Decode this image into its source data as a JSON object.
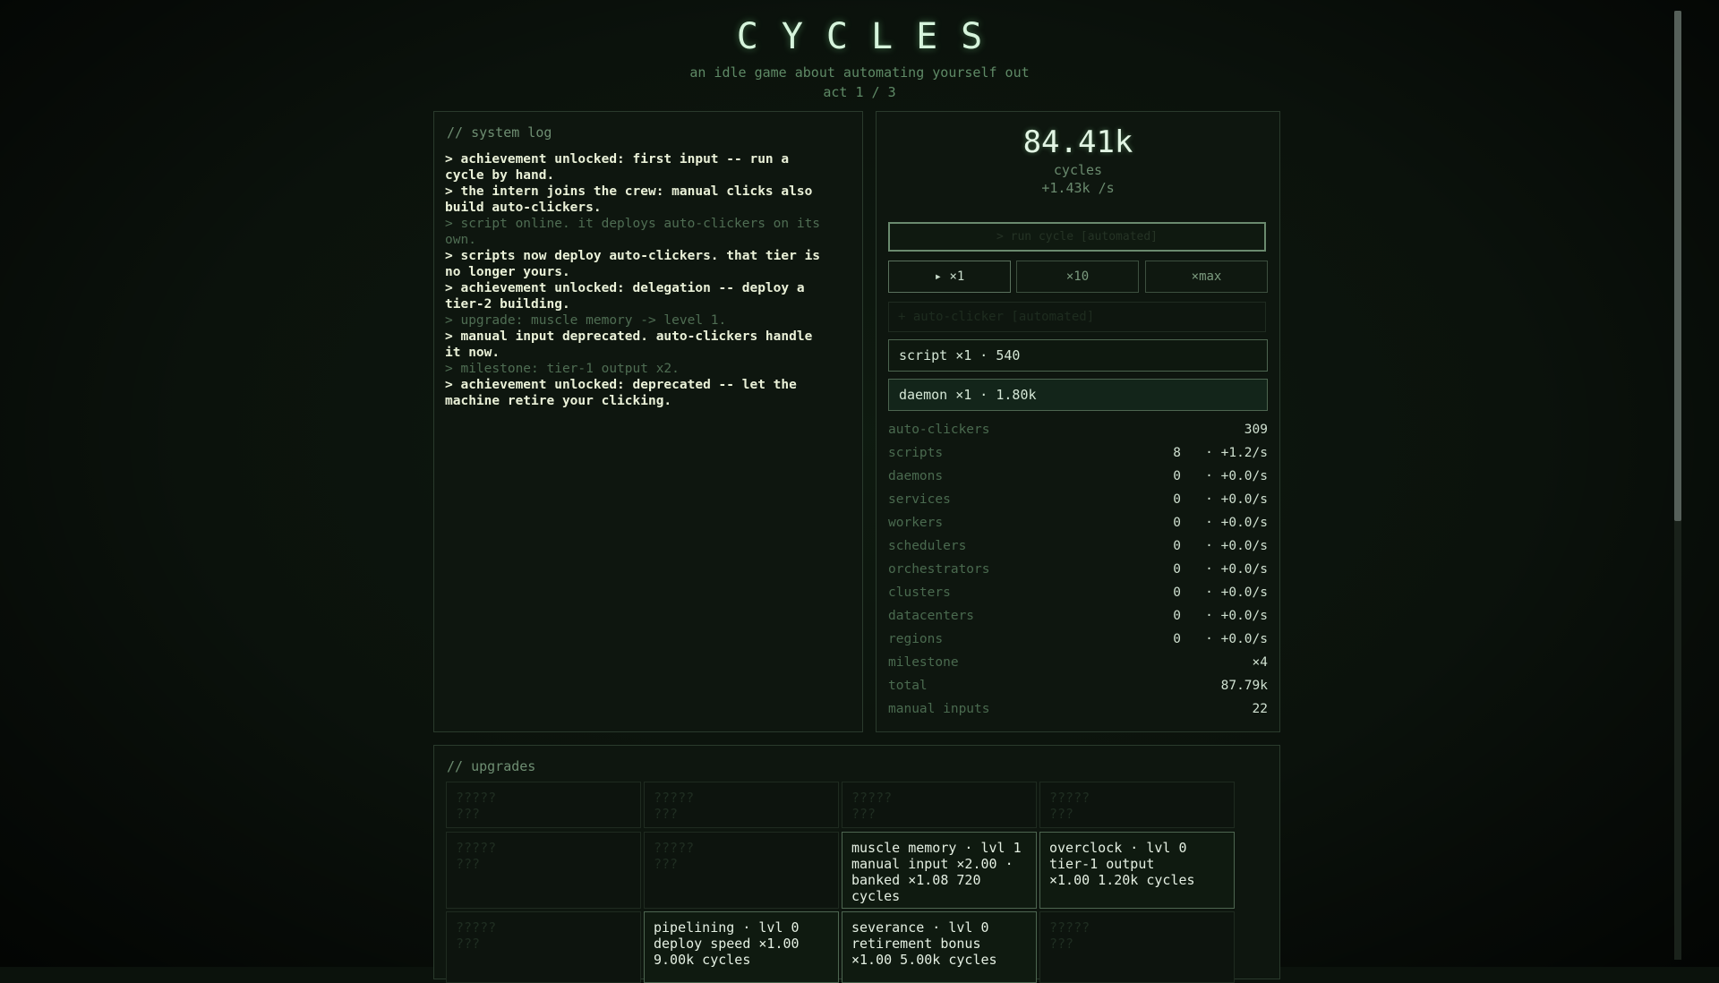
{
  "header": {
    "title": "CYCLES",
    "subtitle": "an idle game about automating yourself out",
    "act": "act 1 / 3"
  },
  "log": {
    "title": "// system log",
    "lines": [
      {
        "text": "> achievement unlocked: first input -- run a",
        "dim": false
      },
      {
        "text": "cycle by hand.",
        "dim": false
      },
      {
        "text": "> the intern joins the crew: manual clicks also",
        "dim": false
      },
      {
        "text": "build auto-clickers.",
        "dim": false
      },
      {
        "text": "> script online. it deploys auto-clickers on its",
        "dim": true
      },
      {
        "text": "own.",
        "dim": true
      },
      {
        "text": "> scripts now deploy auto-clickers. that tier is",
        "dim": false
      },
      {
        "text": "no longer yours.",
        "dim": false
      },
      {
        "text": "> achievement unlocked: delegation -- deploy a",
        "dim": false
      },
      {
        "text": "tier-2 building.",
        "dim": false
      },
      {
        "text": "> upgrade: muscle memory -> level 1.",
        "dim": true
      },
      {
        "text": "> manual input deprecated. auto-clickers handle",
        "dim": false
      },
      {
        "text": "it now.",
        "dim": false
      },
      {
        "text": "> milestone: tier-1 output x2.",
        "dim": true
      },
      {
        "text": "> achievement unlocked: deprecated -- let the",
        "dim": false
      },
      {
        "text": "machine retire your clicking.",
        "dim": false
      }
    ]
  },
  "stats": {
    "cycles_value": "84.41k",
    "cycles_label": "cycles",
    "cycles_rate": "+1.43k /s",
    "run_button": "> run cycle  [automated]",
    "multipliers": [
      "▸ ×1",
      "×10",
      "×max"
    ],
    "auto_clicker_button": "+ auto-clicker  [automated]",
    "build_script": "script  ×1 · 540",
    "build_daemon": "daemon  ×1 · 1.80k",
    "rows": [
      {
        "name": "auto-clickers",
        "value": "309"
      },
      {
        "name": "scripts",
        "count": "8",
        "rate": "· +1.2/s"
      },
      {
        "name": "daemons",
        "count": "0",
        "rate": "· +0.0/s"
      },
      {
        "name": "services",
        "count": "0",
        "rate": "· +0.0/s"
      },
      {
        "name": "workers",
        "count": "0",
        "rate": "· +0.0/s"
      },
      {
        "name": "schedulers",
        "count": "0",
        "rate": "· +0.0/s"
      },
      {
        "name": "orchestrators",
        "count": "0",
        "rate": "· +0.0/s"
      },
      {
        "name": "clusters",
        "count": "0",
        "rate": "· +0.0/s"
      },
      {
        "name": "datacenters",
        "count": "0",
        "rate": "· +0.0/s"
      },
      {
        "name": "regions",
        "count": "0",
        "rate": "· +0.0/s"
      },
      {
        "name": "milestone",
        "value": "×4"
      },
      {
        "name": "total",
        "value": "87.79k"
      },
      {
        "name": "manual inputs",
        "value": "22"
      }
    ]
  },
  "upgrades": {
    "title": "// upgrades",
    "cards": [
      {
        "text": "?????\n???",
        "locked": true
      },
      {
        "text": "?????\n???",
        "locked": true
      },
      {
        "text": "?????\n???",
        "locked": true
      },
      {
        "text": "?????\n???",
        "locked": true
      },
      {
        "text": "?????\n???",
        "locked": true
      },
      {
        "text": "?????\n???",
        "locked": true
      },
      {
        "text": "muscle memory · lvl 1\nmanual input ×2.00 ·\nbanked ×1.08   720\ncycles",
        "locked": false
      },
      {
        "text": "overclock · lvl 0\ntier-1 output\n×1.00   1.20k cycles",
        "locked": false
      },
      {
        "text": "?????\n???",
        "locked": true
      },
      {
        "text": "pipelining · lvl 0\ndeploy speed ×1.00\n9.00k cycles",
        "locked": false
      },
      {
        "text": "severance · lvl 0\nretirement bonus\n×1.00   5.00k cycles",
        "locked": false
      },
      {
        "text": "?????\n???",
        "locked": true
      }
    ]
  }
}
